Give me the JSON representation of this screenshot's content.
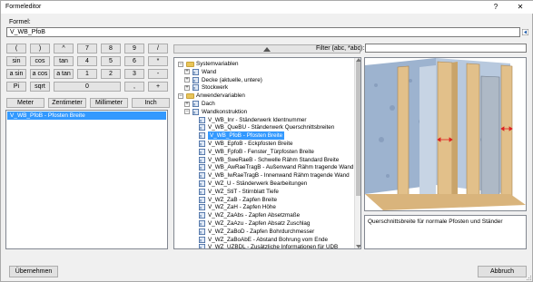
{
  "window": {
    "title": "Formeleditor",
    "help_label": "?",
    "close_label": "✕"
  },
  "formula": {
    "label": "Formel:",
    "value": "V_WB_PfoB"
  },
  "keypad": {
    "rows": [
      [
        "(",
        ")",
        "^",
        "7",
        "8",
        "9",
        "/"
      ],
      [
        "sin",
        "cos",
        "tan",
        "4",
        "5",
        "6",
        "*"
      ],
      [
        "a sin",
        "a cos",
        "a tan",
        "1",
        "2",
        "3",
        "-"
      ],
      [
        "Pi",
        "sqrt",
        "0",
        ",",
        "+"
      ]
    ]
  },
  "units": [
    "Meter",
    "Zentimeter",
    "Millimeter",
    "Inch"
  ],
  "result_list": [
    "V_WB_PfoB - Pfosten Breite"
  ],
  "filter": {
    "label": "Filter (abc, *abc):",
    "value": ""
  },
  "tree": {
    "system_root": "Systemvariablen",
    "system_items": [
      "Wand",
      "Decke (aktuelle, untere)",
      "Stockwerk"
    ],
    "user_root": "Anwendervariablen",
    "user_items": [
      "Dach",
      "Wandkonstruktion"
    ],
    "wall_vars": [
      "V_WB_Inr - Ständerwerk Identnummer",
      "V_WB_QueBU - Ständerwerk Querschnittsbreiten",
      "V_WB_PfoB - Pfosten Breite",
      "V_WB_EpfoB - Eckpfosten Breite",
      "V_WB_FpfoB - Fenster_Türpfosten Breite",
      "V_WB_SweRaeB - Schwelle Rähm Standard Breite",
      "V_WB_AwRaeTragB - Außenwand Rähm tragende Wand",
      "V_WB_IwRaeTragB - Innenwand Rähm tragende Wand",
      "V_WZ_U - Ständerwerk Bearbeitungen",
      "V_WZ_StiT - Stirnblatt Tiefe",
      "V_WZ_ZaB - Zapfen Breite",
      "V_WZ_ZaH - Zapfen Höhe",
      "V_WZ_ZaAbs - Zapfen Absetzmaße",
      "V_WZ_ZaAzu - Zapfen Absatz Zuschlag",
      "V_WZ_ZaBoD - Zapfen Bohrdurchmesser",
      "V_WZ_ZaBoAbE - Abstand Bohrung vom Ende",
      "V_WZ_UZBDL - Zusätzliche Informationen für UDB"
    ],
    "selected_index": 2
  },
  "description": "Querschnittsbreite für normale Pfosten und Ständer",
  "buttons": {
    "apply": "Übernehmen",
    "cancel": "Abbruch"
  },
  "colors": {
    "selection": "#3399ff",
    "folder": "#e8c55a",
    "wood": "#e2c08a",
    "board": "#8fa9c9"
  }
}
